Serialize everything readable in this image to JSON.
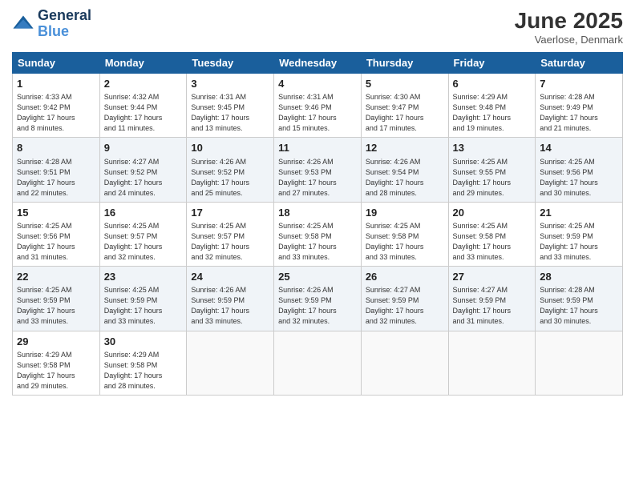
{
  "header": {
    "logo_line1": "General",
    "logo_line2": "Blue",
    "month_title": "June 2025",
    "location": "Vaerlose, Denmark"
  },
  "days_of_week": [
    "Sunday",
    "Monday",
    "Tuesday",
    "Wednesday",
    "Thursday",
    "Friday",
    "Saturday"
  ],
  "weeks": [
    [
      {
        "day": "1",
        "info": "Sunrise: 4:33 AM\nSunset: 9:42 PM\nDaylight: 17 hours\nand 8 minutes."
      },
      {
        "day": "2",
        "info": "Sunrise: 4:32 AM\nSunset: 9:44 PM\nDaylight: 17 hours\nand 11 minutes."
      },
      {
        "day": "3",
        "info": "Sunrise: 4:31 AM\nSunset: 9:45 PM\nDaylight: 17 hours\nand 13 minutes."
      },
      {
        "day": "4",
        "info": "Sunrise: 4:31 AM\nSunset: 9:46 PM\nDaylight: 17 hours\nand 15 minutes."
      },
      {
        "day": "5",
        "info": "Sunrise: 4:30 AM\nSunset: 9:47 PM\nDaylight: 17 hours\nand 17 minutes."
      },
      {
        "day": "6",
        "info": "Sunrise: 4:29 AM\nSunset: 9:48 PM\nDaylight: 17 hours\nand 19 minutes."
      },
      {
        "day": "7",
        "info": "Sunrise: 4:28 AM\nSunset: 9:49 PM\nDaylight: 17 hours\nand 21 minutes."
      }
    ],
    [
      {
        "day": "8",
        "info": "Sunrise: 4:28 AM\nSunset: 9:51 PM\nDaylight: 17 hours\nand 22 minutes."
      },
      {
        "day": "9",
        "info": "Sunrise: 4:27 AM\nSunset: 9:52 PM\nDaylight: 17 hours\nand 24 minutes."
      },
      {
        "day": "10",
        "info": "Sunrise: 4:26 AM\nSunset: 9:52 PM\nDaylight: 17 hours\nand 25 minutes."
      },
      {
        "day": "11",
        "info": "Sunrise: 4:26 AM\nSunset: 9:53 PM\nDaylight: 17 hours\nand 27 minutes."
      },
      {
        "day": "12",
        "info": "Sunrise: 4:26 AM\nSunset: 9:54 PM\nDaylight: 17 hours\nand 28 minutes."
      },
      {
        "day": "13",
        "info": "Sunrise: 4:25 AM\nSunset: 9:55 PM\nDaylight: 17 hours\nand 29 minutes."
      },
      {
        "day": "14",
        "info": "Sunrise: 4:25 AM\nSunset: 9:56 PM\nDaylight: 17 hours\nand 30 minutes."
      }
    ],
    [
      {
        "day": "15",
        "info": "Sunrise: 4:25 AM\nSunset: 9:56 PM\nDaylight: 17 hours\nand 31 minutes."
      },
      {
        "day": "16",
        "info": "Sunrise: 4:25 AM\nSunset: 9:57 PM\nDaylight: 17 hours\nand 32 minutes."
      },
      {
        "day": "17",
        "info": "Sunrise: 4:25 AM\nSunset: 9:57 PM\nDaylight: 17 hours\nand 32 minutes."
      },
      {
        "day": "18",
        "info": "Sunrise: 4:25 AM\nSunset: 9:58 PM\nDaylight: 17 hours\nand 33 minutes."
      },
      {
        "day": "19",
        "info": "Sunrise: 4:25 AM\nSunset: 9:58 PM\nDaylight: 17 hours\nand 33 minutes."
      },
      {
        "day": "20",
        "info": "Sunrise: 4:25 AM\nSunset: 9:58 PM\nDaylight: 17 hours\nand 33 minutes."
      },
      {
        "day": "21",
        "info": "Sunrise: 4:25 AM\nSunset: 9:59 PM\nDaylight: 17 hours\nand 33 minutes."
      }
    ],
    [
      {
        "day": "22",
        "info": "Sunrise: 4:25 AM\nSunset: 9:59 PM\nDaylight: 17 hours\nand 33 minutes."
      },
      {
        "day": "23",
        "info": "Sunrise: 4:25 AM\nSunset: 9:59 PM\nDaylight: 17 hours\nand 33 minutes."
      },
      {
        "day": "24",
        "info": "Sunrise: 4:26 AM\nSunset: 9:59 PM\nDaylight: 17 hours\nand 33 minutes."
      },
      {
        "day": "25",
        "info": "Sunrise: 4:26 AM\nSunset: 9:59 PM\nDaylight: 17 hours\nand 32 minutes."
      },
      {
        "day": "26",
        "info": "Sunrise: 4:27 AM\nSunset: 9:59 PM\nDaylight: 17 hours\nand 32 minutes."
      },
      {
        "day": "27",
        "info": "Sunrise: 4:27 AM\nSunset: 9:59 PM\nDaylight: 17 hours\nand 31 minutes."
      },
      {
        "day": "28",
        "info": "Sunrise: 4:28 AM\nSunset: 9:59 PM\nDaylight: 17 hours\nand 30 minutes."
      }
    ],
    [
      {
        "day": "29",
        "info": "Sunrise: 4:29 AM\nSunset: 9:58 PM\nDaylight: 17 hours\nand 29 minutes."
      },
      {
        "day": "30",
        "info": "Sunrise: 4:29 AM\nSunset: 9:58 PM\nDaylight: 17 hours\nand 28 minutes."
      },
      {
        "day": "",
        "info": ""
      },
      {
        "day": "",
        "info": ""
      },
      {
        "day": "",
        "info": ""
      },
      {
        "day": "",
        "info": ""
      },
      {
        "day": "",
        "info": ""
      }
    ]
  ]
}
